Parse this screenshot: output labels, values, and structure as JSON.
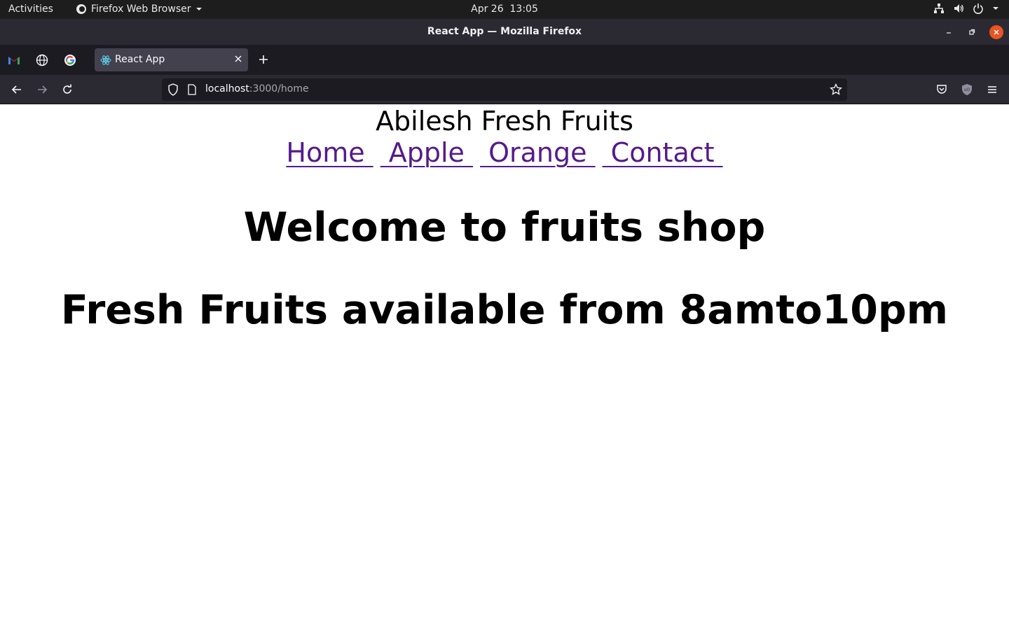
{
  "system_bar": {
    "activities": "Activities",
    "app_menu": "Firefox Web Browser",
    "date": "Apr 26",
    "time": "13:05",
    "tray_icons": [
      "network-icon",
      "volume-icon",
      "power-icon",
      "chevron-down-icon"
    ]
  },
  "window": {
    "title": "React App — Mozilla Firefox"
  },
  "tabs": {
    "pinned": [
      {
        "name": "gmail",
        "icon": "gmail-icon"
      },
      {
        "name": "globe",
        "icon": "globe-icon"
      },
      {
        "name": "google",
        "icon": "google-icon"
      }
    ],
    "active_label": "React App",
    "active_icon": "react-icon"
  },
  "navbar": {
    "url_host": "localhost",
    "url_rest": ":3000/home"
  },
  "page": {
    "site_title": "Abilesh Fresh Fruits",
    "links": [
      "Home ",
      " Apple ",
      " Orange ",
      " Contact "
    ],
    "heading1": "Welcome to fruits shop",
    "heading2": "Fresh Fruits available from 8amto10pm",
    "link_color": "#551a8b"
  },
  "colors": {
    "system_bar": "#1d1d1d",
    "titlebar": "#2b2a33",
    "tabstrip": "#1c1b22",
    "close_button": "#e95420"
  }
}
